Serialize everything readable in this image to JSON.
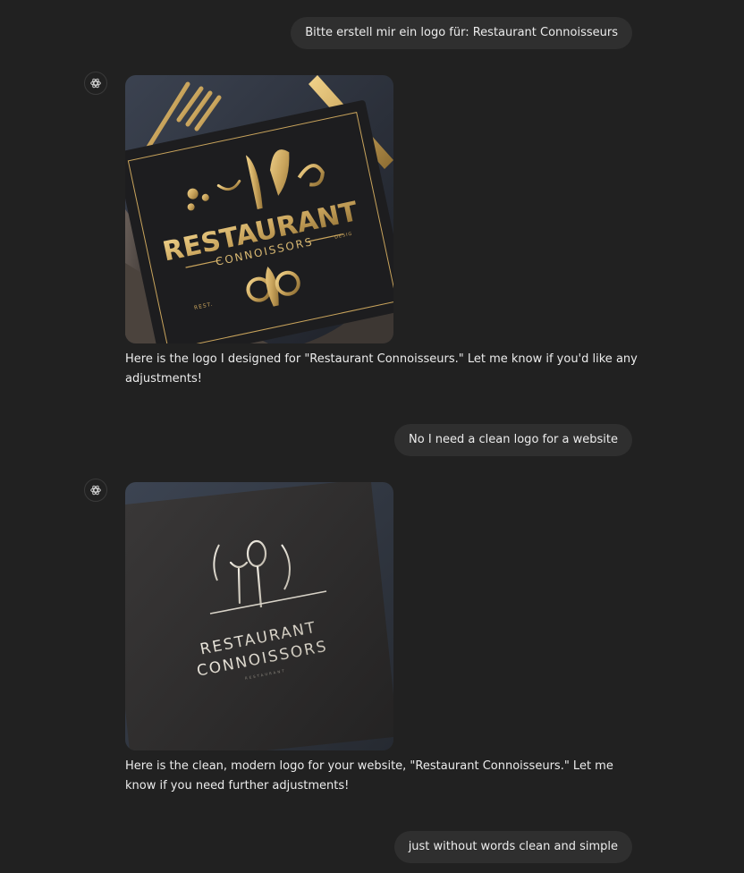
{
  "messages": {
    "user_1": "Bitte erstell mir ein logo für: Restaurant Connoisseurs",
    "assistant_1": "Here is the logo I designed for \"Restaurant Connoisseurs.\" Let me know if you'd like any adjustments!",
    "user_2": "No I need a clean logo for a  website",
    "assistant_2": "Here is the clean, modern logo for your website, \"Restaurant Connoisseurs.\" Let me know if you need further adjustments!",
    "user_3": "just without words clean and simple"
  },
  "images": {
    "image_1": {
      "word_top": "RESTAURANT",
      "word_bottom": "CONNOISSORS",
      "small_left": "REST.",
      "small_right": "DESIG"
    },
    "image_2": {
      "word_top": "RESTAURANT",
      "word_bottom": "CONNOISSORS",
      "tagline": "RESTAURANT"
    }
  },
  "icons": {
    "assistant_avatar": "openai-logo-icon"
  },
  "colors": {
    "background": "#212121",
    "user_bubble": "#2f2f2f",
    "text": "#ececec",
    "gold": "#c9a45c"
  }
}
